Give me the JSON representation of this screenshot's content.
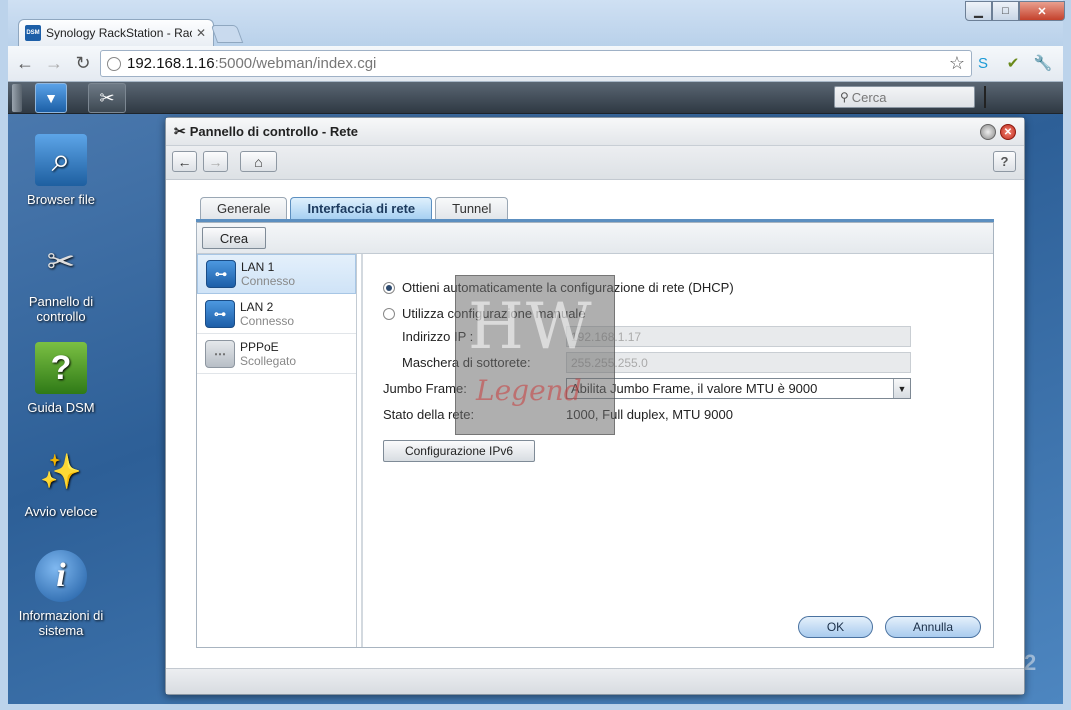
{
  "browser": {
    "tab_title": "Synology RackStation - Rac",
    "tab_favicon_text": "DSM",
    "url_host": "192.168.1.16",
    "url_path": ":5000/webman/index.cgi"
  },
  "dsm": {
    "search_placeholder": "Cerca"
  },
  "desktop": {
    "icons": [
      {
        "label": "Browser file",
        "icon": "folder-search-icon"
      },
      {
        "label": "Pannello di controllo",
        "icon": "tools-icon"
      },
      {
        "label": "Guida DSM",
        "icon": "help-book-icon"
      },
      {
        "label": "Avvio veloce",
        "icon": "magic-wand-icon"
      },
      {
        "label": "Informazioni di sistema",
        "icon": "info-icon"
      }
    ]
  },
  "window": {
    "title": "Pannello di controllo - Rete"
  },
  "tabs": [
    "Generale",
    "Interfaccia di rete",
    "Tunnel"
  ],
  "active_tab": "Interfaccia di rete",
  "toolbar": {
    "create_label": "Crea"
  },
  "interfaces": [
    {
      "name": "LAN 1",
      "status": "Connesso",
      "selected": true
    },
    {
      "name": "LAN 2",
      "status": "Connesso",
      "selected": false
    },
    {
      "name": "PPPoE",
      "status": "Scollegato",
      "selected": false
    }
  ],
  "form": {
    "radio_dhcp": "Ottieni automaticamente la configurazione di rete (DHCP)",
    "radio_manual": "Utilizza configurazione manuale",
    "dhcp_selected": true,
    "ip_label": "Indirizzo IP :",
    "ip_value": "192.168.1.17",
    "mask_label": "Maschera di sottorete:",
    "mask_value": "255.255.255.0",
    "jumbo_label": "Jumbo Frame:",
    "jumbo_value": "Abilita Jumbo Frame, il valore MTU è 9000",
    "status_label": "Stato della rete:",
    "status_value": "1000, Full duplex, MTU 9000",
    "ipv6_button": "Configurazione IPv6",
    "ok_button": "OK",
    "cancel_button": "Annulla"
  },
  "watermark": {
    "big": "HW",
    "small": "Legend"
  }
}
